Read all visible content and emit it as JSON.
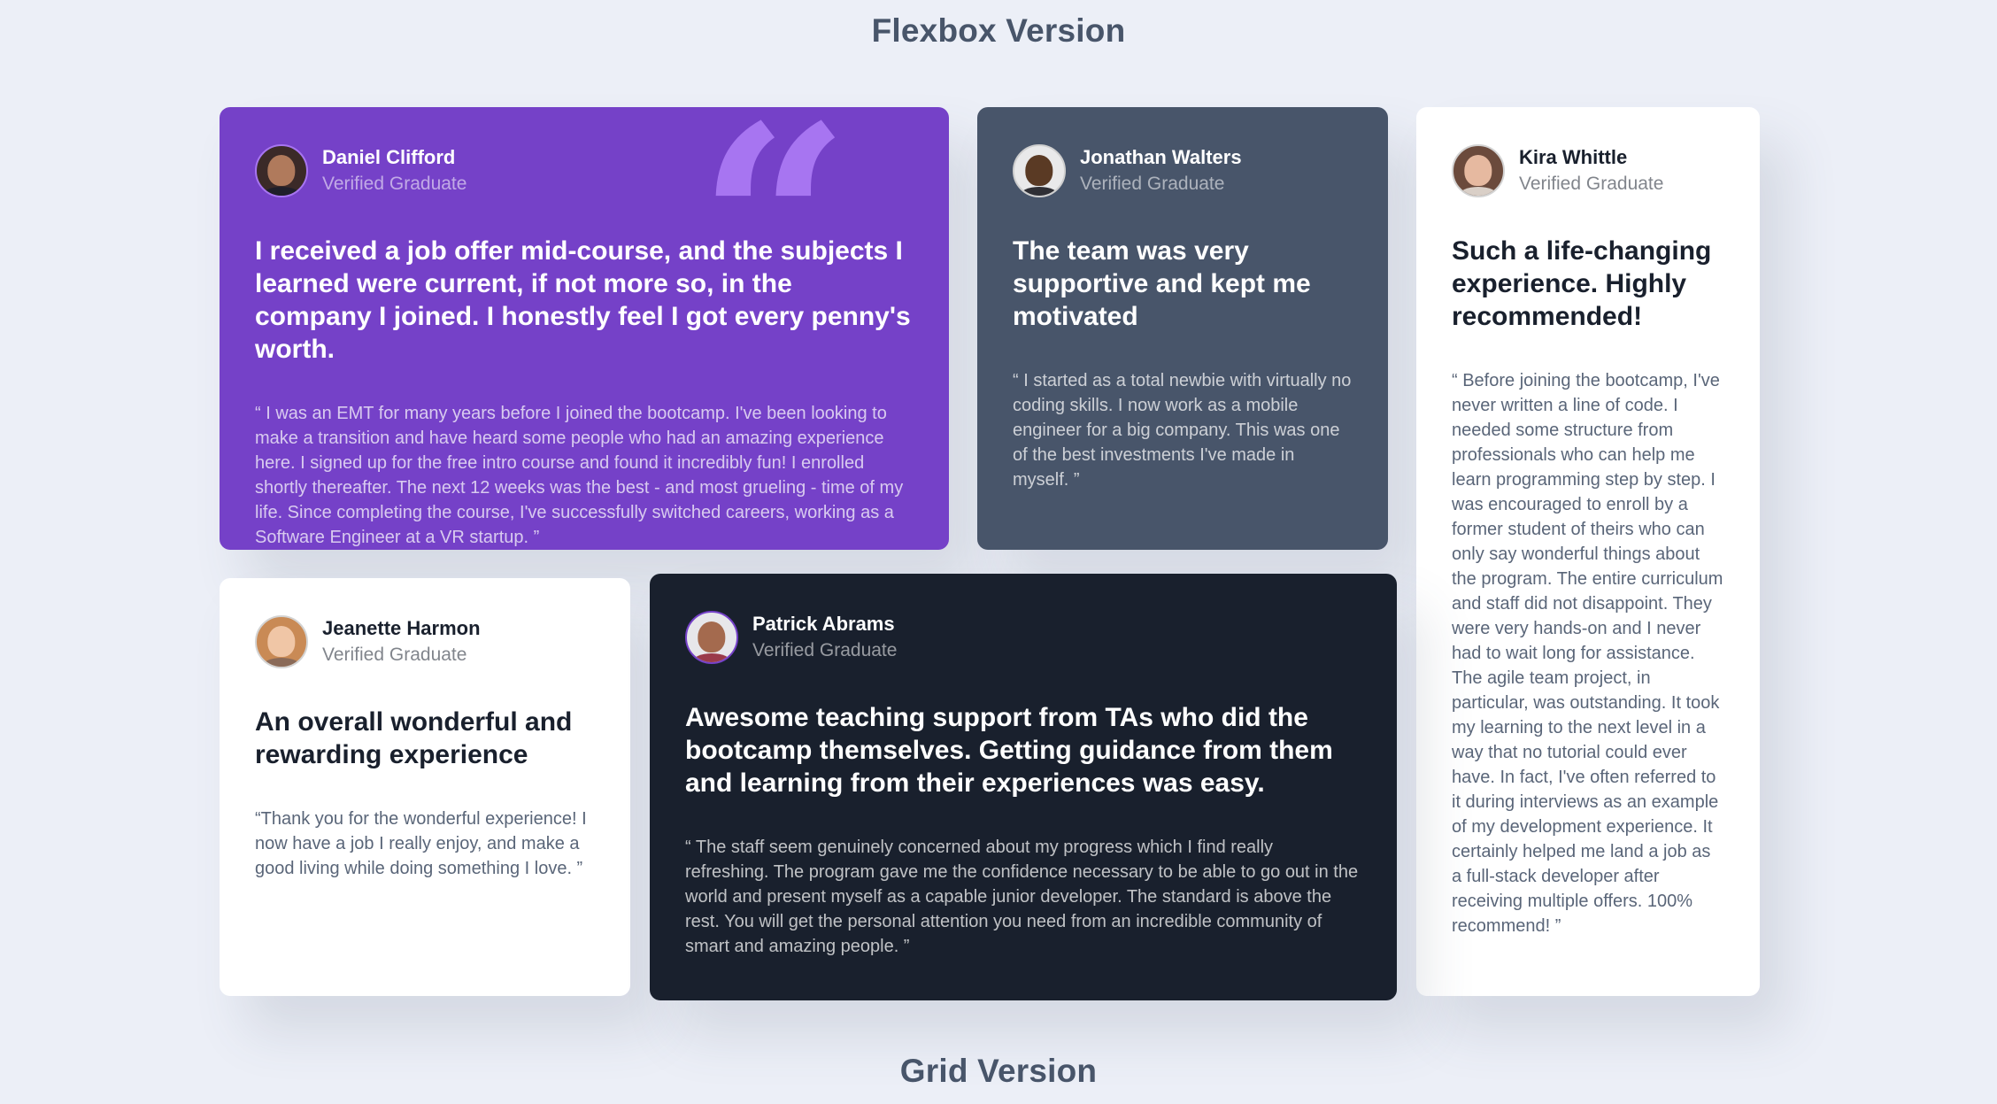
{
  "titles": {
    "flexbox": "Flexbox Version",
    "grid": "Grid Version"
  },
  "testimonials": [
    {
      "name": "Daniel Clifford",
      "role": "Verified Graduate",
      "headline": "I received a job offer mid-course, and the subjects I learned were current, if not more so, in the company I joined. I honestly feel I got every penny's worth.",
      "body": "“ I was an EMT for many years before I joined the bootcamp. I've been looking to make a transition and have heard some people who had an amazing experience here. I signed up for the free intro course and found it incredibly fun! I enrolled shortly thereafter. The next 12 weeks was the best - and most grueling - time of my life. Since completing the course, I've successfully switched careers, working as a Software Engineer at a VR startup. ”",
      "theme": "purple",
      "accent": "#7541c8"
    },
    {
      "name": "Jonathan Walters",
      "role": "Verified Graduate",
      "headline": "The team was very supportive and kept me motivated",
      "body": "“ I started as a total newbie with virtually no coding skills. I now work as a mobile engineer for a big company. This was one of the best investments I've made in myself. ”",
      "theme": "slate",
      "accent": "#48556a"
    },
    {
      "name": "Kira Whittle",
      "role": "Verified Graduate",
      "headline": "Such a life-changing experience. Highly recommended!",
      "body": "“ Before joining the bootcamp, I've never written a line of code. I needed some structure from professionals who can help me learn programming step by step. I was encouraged to enroll by a former student of theirs who can only say wonderful things about the program. The entire curriculum and staff did not disappoint. They were very hands-on and I never had to wait long for assistance. The agile team project, in particular, was outstanding. It took my learning to the next level in a way that no tutorial could ever have. In fact, I've often referred to it during interviews as an example of my development experience. It certainly helped me land a job as a full-stack developer after receiving multiple offers. 100% recommend! ”",
      "theme": "white",
      "accent": "#ffffff"
    },
    {
      "name": "Jeanette Harmon",
      "role": "Verified Graduate",
      "headline": "An overall wonderful and rewarding experience",
      "body": "“Thank you for the wonderful experience! I now have a job I really enjoy, and make a good living while doing something I love. ”",
      "theme": "white",
      "accent": "#ffffff"
    },
    {
      "name": "Patrick Abrams",
      "role": "Verified Graduate",
      "headline": "Awesome teaching support from TAs who did the bootcamp themselves. Getting guidance from them and learning from their experiences was easy.",
      "body": "“ The staff seem genuinely concerned about my progress which I find really refreshing. The program gave me the confidence necessary to be able to go out in the world and present myself as a capable junior developer. The standard is above the rest. You will get the personal attention you need from an incredible community of smart and amazing people. ”",
      "theme": "dark",
      "accent": "#19202d"
    }
  ],
  "colors": {
    "background": "#eceff7",
    "purple": "#7541c8",
    "slate": "#48556a",
    "dark": "#19202d",
    "white": "#ffffff",
    "quote_mark": "#a775f1"
  },
  "icons": {
    "quote": "quotation-mark-icon"
  }
}
